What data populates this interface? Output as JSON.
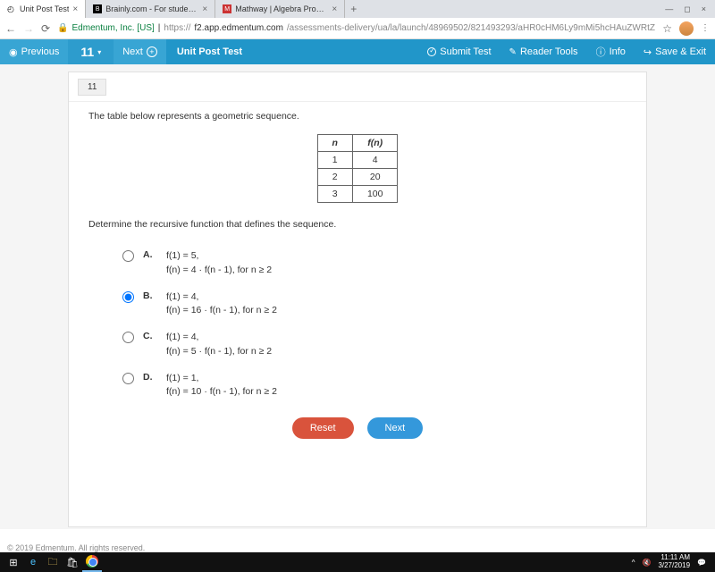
{
  "browser": {
    "tabs": [
      {
        "title": "Unit Post Test",
        "active": true
      },
      {
        "title": "Brainly.com - For students. By stu"
      },
      {
        "title": "Mathway | Algebra Problem Solv"
      }
    ],
    "url_host_label": "Edmentum, Inc. [US]",
    "url_prefix": "https://",
    "url_host": "f2.app.edmentum.com",
    "url_path": "/assessments-delivery/ua/la/launch/48969502/821493293/aHR0cHM6Ly9mMi5hcHAuZWRtZW50dW0uY29tL2x..."
  },
  "appbar": {
    "previous": "Previous",
    "page": "11",
    "next": "Next",
    "title": "Unit Post Test",
    "submit": "Submit Test",
    "reader": "Reader Tools",
    "info": "Info",
    "save_exit": "Save & Exit"
  },
  "question": {
    "number": "11",
    "prompt1": "The table below represents a geometric sequence.",
    "prompt2": "Determine the recursive function that defines the sequence.",
    "table": {
      "head_n": "n",
      "head_fn": "f(n)",
      "rows": [
        {
          "n": "1",
          "fn": "4"
        },
        {
          "n": "2",
          "fn": "20"
        },
        {
          "n": "3",
          "fn": "100"
        }
      ]
    },
    "options": [
      {
        "letter": "A.",
        "line1": "f(1) = 5,",
        "line2": "f(n) = 4 · f(n - 1), for n ≥ 2",
        "selected": false
      },
      {
        "letter": "B.",
        "line1": "f(1) = 4,",
        "line2": "f(n) = 16 · f(n - 1), for n ≥ 2",
        "selected": true
      },
      {
        "letter": "C.",
        "line1": "f(1) = 4,",
        "line2": "f(n) = 5 · f(n - 1), for n ≥ 2",
        "selected": false
      },
      {
        "letter": "D.",
        "line1": "f(1) = 1,",
        "line2": "f(n) = 10 · f(n - 1), for n ≥ 2",
        "selected": false
      }
    ],
    "reset": "Reset",
    "next_btn": "Next"
  },
  "footer": "© 2019 Edmentum. All rights reserved.",
  "tray": {
    "time": "11:11 AM",
    "date": "3/27/2019"
  }
}
